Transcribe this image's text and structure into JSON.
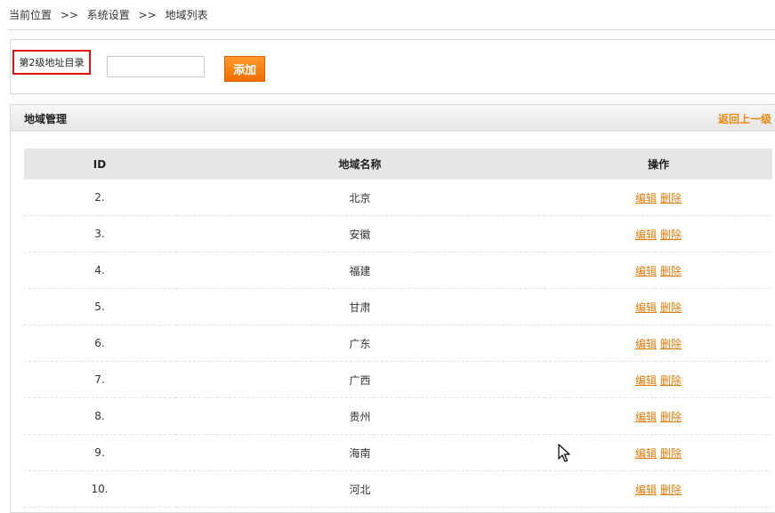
{
  "breadcrumb": {
    "items": [
      "当前位置",
      "系统设置",
      "地域列表"
    ],
    "separator": ">>"
  },
  "add_form": {
    "level_label": "第2级地址目录",
    "input_value": "",
    "add_button_label": "添加"
  },
  "region_panel": {
    "title": "地域管理",
    "back_link": "返回上一级",
    "columns": [
      "ID",
      "地域名称",
      "操作"
    ],
    "rows": [
      {
        "id": "2.",
        "name": "北京"
      },
      {
        "id": "3.",
        "name": "安徽"
      },
      {
        "id": "4.",
        "name": "福建"
      },
      {
        "id": "5.",
        "name": "甘肃"
      },
      {
        "id": "6.",
        "name": "广东"
      },
      {
        "id": "7.",
        "name": "广西"
      },
      {
        "id": "8.",
        "name": "贵州"
      },
      {
        "id": "9.",
        "name": "海南"
      },
      {
        "id": "10.",
        "name": "河北"
      }
    ],
    "edit_label": "编辑",
    "delete_label": "删除"
  },
  "colors": {
    "accent": "#e8870c",
    "highlight_border": "#e01010",
    "button": "#f58300"
  },
  "icons": {
    "cursor": "mouse-pointer-icon"
  }
}
